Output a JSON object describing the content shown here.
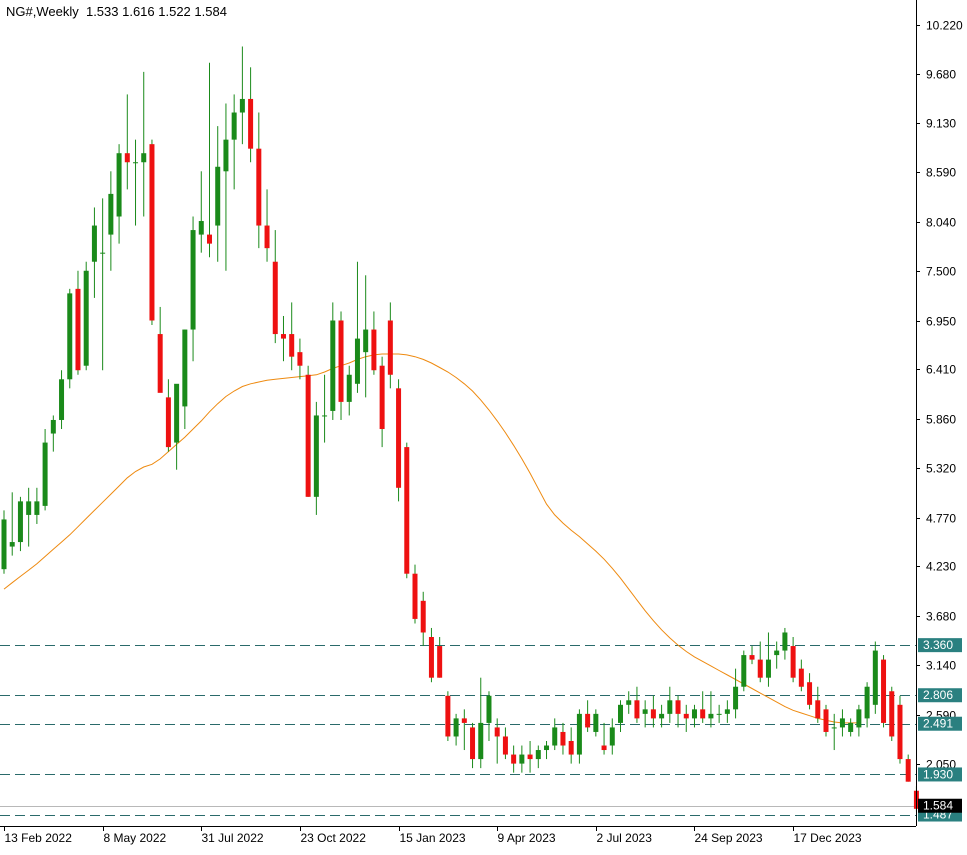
{
  "header": {
    "symbol_timeframe": "NG#,Weekly",
    "ohlc": "1.533 1.616 1.522 1.584"
  },
  "colors": {
    "background": "#ffffff",
    "bull_body": "#1a8a1a",
    "bear_body": "#ee1111",
    "wick": "#1a8a1a",
    "ma_line": "#ee8a10",
    "level_line": "#2a6a6a",
    "level_label_bg": "#2a8080",
    "price_label_bg": "#000000",
    "axis": "#000000"
  },
  "chart_data": {
    "type": "candlestick",
    "title": "NG#,Weekly",
    "ylim": [
      1.36,
      10.45
    ],
    "y_ticks": [
      {
        "value": 10.22,
        "label": "10.220"
      },
      {
        "value": 9.68,
        "label": "9.680"
      },
      {
        "value": 9.13,
        "label": "9.130"
      },
      {
        "value": 8.59,
        "label": "8.590"
      },
      {
        "value": 8.04,
        "label": "8.040"
      },
      {
        "value": 7.5,
        "label": "7.500"
      },
      {
        "value": 6.95,
        "label": "6.950"
      },
      {
        "value": 6.41,
        "label": "6.410"
      },
      {
        "value": 5.86,
        "label": "5.860"
      },
      {
        "value": 5.32,
        "label": "5.320"
      },
      {
        "value": 4.77,
        "label": "4.770"
      },
      {
        "value": 4.23,
        "label": "4.230"
      },
      {
        "value": 3.68,
        "label": "3.680"
      },
      {
        "value": 3.14,
        "label": "3.140"
      },
      {
        "value": 2.59,
        "label": "2.590"
      },
      {
        "value": 2.05,
        "label": "2.050"
      }
    ],
    "x_ticks": [
      {
        "index": 0,
        "label": "13 Feb 2022"
      },
      {
        "index": 12,
        "label": "8 May 2022"
      },
      {
        "index": 24,
        "label": "31 Jul 2022"
      },
      {
        "index": 36,
        "label": "23 Oct 2022"
      },
      {
        "index": 48,
        "label": "15 Jan 2023"
      },
      {
        "index": 60,
        "label": "9 Apr 2023"
      },
      {
        "index": 72,
        "label": "2 Jul 2023"
      },
      {
        "index": 84,
        "label": "24 Sep 2023"
      },
      {
        "index": 96,
        "label": "17 Dec 2023"
      }
    ],
    "candles": [
      {
        "o": 4.2,
        "h": 4.85,
        "l": 4.15,
        "c": 4.75
      },
      {
        "o": 4.45,
        "h": 5.05,
        "l": 4.35,
        "c": 4.5
      },
      {
        "o": 4.5,
        "h": 5.0,
        "l": 4.4,
        "c": 4.95
      },
      {
        "o": 4.8,
        "h": 5.1,
        "l": 4.45,
        "c": 4.95
      },
      {
        "o": 4.8,
        "h": 5.1,
        "l": 4.7,
        "c": 4.95
      },
      {
        "o": 4.9,
        "h": 5.75,
        "l": 4.85,
        "c": 5.6
      },
      {
        "o": 5.7,
        "h": 5.9,
        "l": 5.5,
        "c": 5.85
      },
      {
        "o": 5.85,
        "h": 6.4,
        "l": 5.75,
        "c": 6.3
      },
      {
        "o": 6.3,
        "h": 7.3,
        "l": 6.2,
        "c": 7.25
      },
      {
        "o": 7.3,
        "h": 7.5,
        "l": 6.35,
        "c": 6.4
      },
      {
        "o": 6.45,
        "h": 7.6,
        "l": 6.4,
        "c": 7.5
      },
      {
        "o": 7.6,
        "h": 8.2,
        "l": 7.2,
        "c": 8.0
      },
      {
        "o": 7.7,
        "h": 8.3,
        "l": 6.4,
        "c": 7.7
      },
      {
        "o": 7.9,
        "h": 8.6,
        "l": 7.5,
        "c": 8.35
      },
      {
        "o": 8.1,
        "h": 8.9,
        "l": 7.8,
        "c": 8.8
      },
      {
        "o": 8.8,
        "h": 9.45,
        "l": 8.4,
        "c": 8.7
      },
      {
        "o": 8.7,
        "h": 8.95,
        "l": 8.0,
        "c": 8.7
      },
      {
        "o": 8.7,
        "h": 9.7,
        "l": 8.1,
        "c": 8.8
      },
      {
        "o": 8.9,
        "h": 8.95,
        "l": 6.9,
        "c": 6.95
      },
      {
        "o": 6.8,
        "h": 7.1,
        "l": 6.2,
        "c": 6.15
      },
      {
        "o": 6.1,
        "h": 6.3,
        "l": 5.5,
        "c": 5.55
      },
      {
        "o": 5.6,
        "h": 6.2,
        "l": 5.3,
        "c": 6.25
      },
      {
        "o": 6.0,
        "h": 6.85,
        "l": 5.75,
        "c": 6.85
      },
      {
        "o": 6.85,
        "h": 8.1,
        "l": 6.5,
        "c": 7.95
      },
      {
        "o": 7.9,
        "h": 8.6,
        "l": 7.7,
        "c": 8.05
      },
      {
        "o": 7.9,
        "h": 9.8,
        "l": 7.65,
        "c": 7.8
      },
      {
        "o": 8.0,
        "h": 9.1,
        "l": 7.6,
        "c": 8.65
      },
      {
        "o": 8.6,
        "h": 9.35,
        "l": 7.5,
        "c": 8.95
      },
      {
        "o": 8.95,
        "h": 9.45,
        "l": 8.4,
        "c": 9.25
      },
      {
        "o": 9.25,
        "h": 9.98,
        "l": 8.9,
        "c": 9.4
      },
      {
        "o": 9.4,
        "h": 9.75,
        "l": 8.7,
        "c": 8.85
      },
      {
        "o": 8.85,
        "h": 9.25,
        "l": 7.75,
        "c": 8.0
      },
      {
        "o": 8.0,
        "h": 8.4,
        "l": 7.6,
        "c": 7.75
      },
      {
        "o": 7.6,
        "h": 7.95,
        "l": 6.7,
        "c": 6.8
      },
      {
        "o": 6.8,
        "h": 7.0,
        "l": 6.5,
        "c": 6.75
      },
      {
        "o": 6.8,
        "h": 7.15,
        "l": 6.4,
        "c": 6.55
      },
      {
        "o": 6.6,
        "h": 6.75,
        "l": 6.3,
        "c": 6.45
      },
      {
        "o": 6.35,
        "h": 6.45,
        "l": 5.0,
        "c": 5.0
      },
      {
        "o": 5.0,
        "h": 6.05,
        "l": 4.8,
        "c": 5.9
      },
      {
        "o": 5.9,
        "h": 6.35,
        "l": 5.6,
        "c": 5.9
      },
      {
        "o": 5.95,
        "h": 7.15,
        "l": 5.85,
        "c": 6.95
      },
      {
        "o": 6.95,
        "h": 7.05,
        "l": 5.85,
        "c": 6.05
      },
      {
        "o": 6.05,
        "h": 6.45,
        "l": 5.9,
        "c": 6.35
      },
      {
        "o": 6.25,
        "h": 7.6,
        "l": 6.15,
        "c": 6.75
      },
      {
        "o": 6.6,
        "h": 7.45,
        "l": 6.1,
        "c": 6.85
      },
      {
        "o": 6.85,
        "h": 7.05,
        "l": 6.35,
        "c": 6.4
      },
      {
        "o": 6.45,
        "h": 6.55,
        "l": 5.55,
        "c": 5.75
      },
      {
        "o": 6.95,
        "h": 7.15,
        "l": 6.2,
        "c": 6.35
      },
      {
        "o": 6.2,
        "h": 6.3,
        "l": 4.95,
        "c": 5.1
      },
      {
        "o": 5.55,
        "h": 5.6,
        "l": 4.1,
        "c": 4.15
      },
      {
        "o": 4.15,
        "h": 4.25,
        "l": 3.6,
        "c": 3.65
      },
      {
        "o": 3.85,
        "h": 3.95,
        "l": 3.35,
        "c": 3.5
      },
      {
        "o": 3.45,
        "h": 3.55,
        "l": 2.95,
        "c": 3.0
      },
      {
        "o": 3.35,
        "h": 3.45,
        "l": 3.0,
        "c": 3.0
      },
      {
        "o": 2.8,
        "h": 2.85,
        "l": 2.3,
        "c": 2.35
      },
      {
        "o": 2.35,
        "h": 2.6,
        "l": 2.25,
        "c": 2.55
      },
      {
        "o": 2.55,
        "h": 2.65,
        "l": 2.2,
        "c": 2.5
      },
      {
        "o": 2.45,
        "h": 2.5,
        "l": 2.0,
        "c": 2.1
      },
      {
        "o": 2.1,
        "h": 3.0,
        "l": 2.0,
        "c": 2.5
      },
      {
        "o": 2.5,
        "h": 2.85,
        "l": 2.3,
        "c": 2.8
      },
      {
        "o": 2.45,
        "h": 2.55,
        "l": 2.05,
        "c": 2.35
      },
      {
        "o": 2.35,
        "h": 2.45,
        "l": 2.1,
        "c": 2.15
      },
      {
        "o": 2.15,
        "h": 2.25,
        "l": 1.95,
        "c": 2.05
      },
      {
        "o": 2.05,
        "h": 2.25,
        "l": 1.95,
        "c": 2.15
      },
      {
        "o": 2.15,
        "h": 2.3,
        "l": 1.95,
        "c": 2.1
      },
      {
        "o": 2.1,
        "h": 2.25,
        "l": 2.0,
        "c": 2.2
      },
      {
        "o": 2.2,
        "h": 2.3,
        "l": 2.1,
        "c": 2.25
      },
      {
        "o": 2.25,
        "h": 2.55,
        "l": 2.2,
        "c": 2.45
      },
      {
        "o": 2.4,
        "h": 2.5,
        "l": 2.15,
        "c": 2.25
      },
      {
        "o": 2.3,
        "h": 2.45,
        "l": 2.05,
        "c": 2.15
      },
      {
        "o": 2.15,
        "h": 2.65,
        "l": 2.05,
        "c": 2.6
      },
      {
        "o": 2.6,
        "h": 2.75,
        "l": 2.4,
        "c": 2.45
      },
      {
        "o": 2.4,
        "h": 2.65,
        "l": 2.35,
        "c": 2.6
      },
      {
        "o": 2.25,
        "h": 2.5,
        "l": 2.15,
        "c": 2.2
      },
      {
        "o": 2.25,
        "h": 2.55,
        "l": 2.15,
        "c": 2.45
      },
      {
        "o": 2.5,
        "h": 2.75,
        "l": 2.4,
        "c": 2.7
      },
      {
        "o": 2.7,
        "h": 2.85,
        "l": 2.6,
        "c": 2.75
      },
      {
        "o": 2.75,
        "h": 2.9,
        "l": 2.5,
        "c": 2.55
      },
      {
        "o": 2.6,
        "h": 2.75,
        "l": 2.45,
        "c": 2.65
      },
      {
        "o": 2.65,
        "h": 2.8,
        "l": 2.45,
        "c": 2.55
      },
      {
        "o": 2.55,
        "h": 2.7,
        "l": 2.45,
        "c": 2.6
      },
      {
        "o": 2.6,
        "h": 2.9,
        "l": 2.5,
        "c": 2.75
      },
      {
        "o": 2.75,
        "h": 2.8,
        "l": 2.45,
        "c": 2.6
      },
      {
        "o": 2.6,
        "h": 2.7,
        "l": 2.4,
        "c": 2.55
      },
      {
        "o": 2.55,
        "h": 2.7,
        "l": 2.45,
        "c": 2.65
      },
      {
        "o": 2.65,
        "h": 2.85,
        "l": 2.5,
        "c": 2.55
      },
      {
        "o": 2.55,
        "h": 2.85,
        "l": 2.45,
        "c": 2.6
      },
      {
        "o": 2.6,
        "h": 2.7,
        "l": 2.5,
        "c": 2.6
      },
      {
        "o": 2.6,
        "h": 2.75,
        "l": 2.5,
        "c": 2.65
      },
      {
        "o": 2.65,
        "h": 3.1,
        "l": 2.55,
        "c": 2.9
      },
      {
        "o": 2.9,
        "h": 3.3,
        "l": 2.85,
        "c": 3.25
      },
      {
        "o": 3.25,
        "h": 3.35,
        "l": 3.15,
        "c": 3.2
      },
      {
        "o": 3.2,
        "h": 3.4,
        "l": 2.95,
        "c": 3.0
      },
      {
        "o": 3.0,
        "h": 3.5,
        "l": 2.9,
        "c": 3.2
      },
      {
        "o": 3.25,
        "h": 3.4,
        "l": 3.1,
        "c": 3.3
      },
      {
        "o": 3.3,
        "h": 3.55,
        "l": 3.2,
        "c": 3.5
      },
      {
        "o": 3.35,
        "h": 3.45,
        "l": 2.95,
        "c": 3.0
      },
      {
        "o": 3.1,
        "h": 3.2,
        "l": 2.85,
        "c": 2.9
      },
      {
        "o": 2.95,
        "h": 3.05,
        "l": 2.65,
        "c": 2.7
      },
      {
        "o": 2.75,
        "h": 2.9,
        "l": 2.5,
        "c": 2.55
      },
      {
        "o": 2.65,
        "h": 2.7,
        "l": 2.35,
        "c": 2.4
      },
      {
        "o": 2.45,
        "h": 2.6,
        "l": 2.2,
        "c": 2.45
      },
      {
        "o": 2.45,
        "h": 2.65,
        "l": 2.35,
        "c": 2.55
      },
      {
        "o": 2.4,
        "h": 2.55,
        "l": 2.35,
        "c": 2.5
      },
      {
        "o": 2.45,
        "h": 2.7,
        "l": 2.35,
        "c": 2.65
      },
      {
        "o": 2.55,
        "h": 2.95,
        "l": 2.45,
        "c": 2.9
      },
      {
        "o": 2.7,
        "h": 3.4,
        "l": 2.6,
        "c": 3.3
      },
      {
        "o": 3.2,
        "h": 3.25,
        "l": 2.45,
        "c": 2.5
      },
      {
        "o": 2.85,
        "h": 2.9,
        "l": 2.3,
        "c": 2.35
      },
      {
        "o": 2.7,
        "h": 2.8,
        "l": 2.05,
        "c": 2.1
      },
      {
        "o": 2.1,
        "h": 2.15,
        "l": 1.85,
        "c": 1.85
      },
      {
        "o": 1.75,
        "h": 1.8,
        "l": 1.52,
        "c": 1.55
      },
      {
        "o": 1.533,
        "h": 1.616,
        "l": 1.522,
        "c": 1.584
      }
    ],
    "moving_average": [
      3.98,
      4.05,
      4.12,
      4.19,
      4.26,
      4.34,
      4.42,
      4.5,
      4.58,
      4.67,
      4.76,
      4.85,
      4.94,
      5.03,
      5.12,
      5.21,
      5.28,
      5.33,
      5.36,
      5.42,
      5.5,
      5.58,
      5.66,
      5.75,
      5.84,
      5.94,
      6.03,
      6.11,
      6.17,
      6.22,
      6.25,
      6.27,
      6.29,
      6.3,
      6.31,
      6.32,
      6.33,
      6.34,
      6.35,
      6.38,
      6.42,
      6.45,
      6.48,
      6.52,
      6.55,
      6.57,
      6.58,
      6.58,
      6.58,
      6.57,
      6.55,
      6.52,
      6.48,
      6.43,
      6.38,
      6.32,
      6.25,
      6.17,
      6.07,
      5.96,
      5.84,
      5.71,
      5.57,
      5.42,
      5.26,
      5.09,
      4.92,
      4.8,
      4.71,
      4.63,
      4.56,
      4.48,
      4.4,
      4.31,
      4.21,
      4.1,
      3.98,
      3.86,
      3.74,
      3.63,
      3.53,
      3.44,
      3.36,
      3.29,
      3.23,
      3.18,
      3.13,
      3.08,
      3.03,
      2.98,
      2.93,
      2.88,
      2.83,
      2.78,
      2.73,
      2.68,
      2.64,
      2.61,
      2.58,
      2.55,
      2.53,
      2.51,
      2.5,
      2.5,
      2.5
    ],
    "horizontal_levels": [
      {
        "value": 3.36,
        "label": "3.360"
      },
      {
        "value": 2.806,
        "label": "2.806"
      },
      {
        "value": 2.491,
        "label": "2.491"
      },
      {
        "value": 1.93,
        "label": "1.930"
      },
      {
        "value": 1.487,
        "label": "1.487"
      }
    ],
    "current_price": {
      "value": 1.584,
      "label": "1.584"
    }
  }
}
